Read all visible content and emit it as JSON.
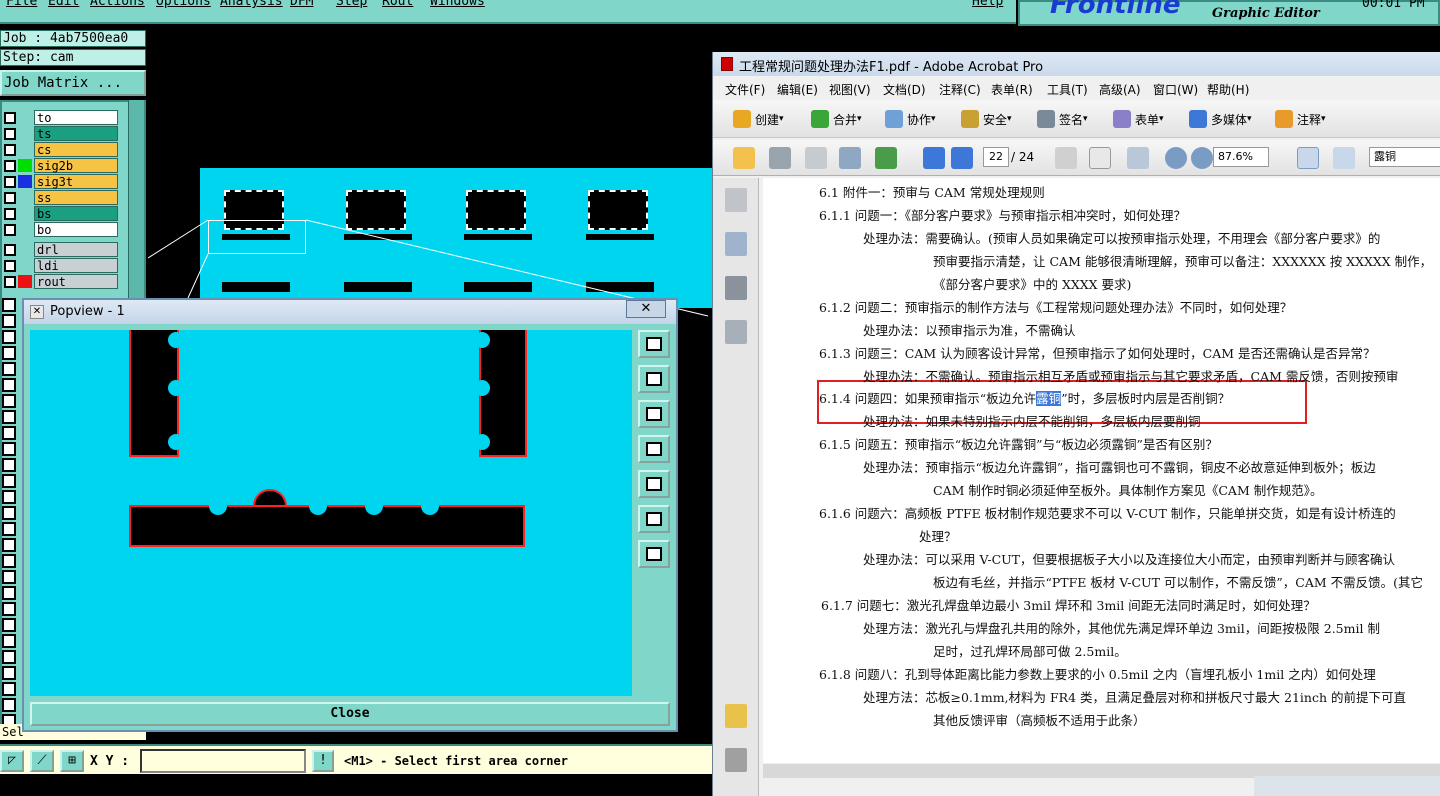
{
  "genesis": {
    "menu": [
      "File",
      "Edit",
      "Actions",
      "Options",
      "Analysis",
      "DFM",
      "Step",
      "Rout",
      "Windows"
    ],
    "help": "Help",
    "brand_logo": "Frontline",
    "brand_sub": "Graphic Editor",
    "brand_time": "00:01 PM",
    "job_label": "Job : 4ab7500ea0",
    "step_label": "Step: cam",
    "job_matrix": "Job Matrix ...",
    "layers": [
      {
        "name": "to",
        "color": "#ffffff"
      },
      {
        "name": "ts",
        "color": "#1aa080"
      },
      {
        "name": "cs",
        "color": "#f6c344"
      },
      {
        "name": "sig2b",
        "color": "#f6c344",
        "swatch": "#00dd00"
      },
      {
        "name": "sig3t",
        "color": "#f6c344",
        "swatch": "#1a2fe0"
      },
      {
        "name": "ss",
        "color": "#f6c344"
      },
      {
        "name": "bs",
        "color": "#1aa080"
      },
      {
        "name": "bo",
        "color": "#ffffff"
      },
      {
        "name": "drl",
        "color": "#c8d0d4"
      },
      {
        "name": "ldi",
        "color": "#c8d0d4"
      },
      {
        "name": "rout",
        "color": "#c8d0d4",
        "swatch": "#ee1111"
      }
    ],
    "sel_strip": "Sel",
    "xy_label": "X Y :",
    "xy_value": "",
    "status_message": "<M1> - Select first area corner"
  },
  "popview": {
    "title": "Popview - 1",
    "close_label": "Close",
    "close_icon": "close-icon"
  },
  "acrobat": {
    "title": "工程常规问题处理办法F1.pdf - Adobe Acrobat Pro",
    "menu": [
      "文件(F)",
      "编辑(E)",
      "视图(V)",
      "文档(D)",
      "注释(C)",
      "表单(R)",
      "工具(T)",
      "高级(A)",
      "窗口(W)",
      "帮助(H)"
    ],
    "toolbar1": [
      "创建",
      "合并",
      "协作",
      "安全",
      "签名",
      "表单",
      "多媒体",
      "注释"
    ],
    "page_current": "22",
    "page_total": "/ 24",
    "zoom": "87.6%",
    "find_text": "露铜",
    "lines": [
      "6.1  附件一：预审与 CAM 常规处理规则",
      "6.1.1 问题一：《部分客户要求》与预审指示相冲突时，如何处理？",
      "处理办法：需要确认。(预审人员如果确定可以按预审指示处理，不用理会《部分客户要求》的",
      "预审要指示清楚，让 CAM 能够很清晰理解，预审可以备注：XXXXXX 按 XXXXX 制作，",
      "《部分客户要求》中的 XXXX 要求)",
      "6.1.2 问题二：预审指示的制作方法与《工程常规问题处理办法》不同时，如何处理？",
      "处理办法：以预审指示为准，不需确认",
      "6.1.3 问题三：CAM 认为顾客设计异常，但预审指示了如何处理时，CAM 是否还需确认是否异常？",
      "处理办法：不需确认。预审指示相互矛盾或预审指示与其它要求矛盾，CAM 需反馈，否则按预审",
      "6.1.4 问题四：如果预审指示“板边允许",
      "露铜",
      "”时，多层板时内层是否削铜？",
      "处理办法：如果未特别指示内层不能削铜，多层板内层要削铜",
      "6.1.5 问题五：预审指示“板边允许露铜”与“板边必须露铜”是否有区别？",
      "处理办法：预审指示“板边允许露铜”，指可露铜也可不露铜，铜皮不必故意延伸到板外；板边",
      "CAM 制作时铜必须延伸至板外。具体制作方案见《CAM 制作规范》。",
      "6.1.6 问题六：高频板 PTFE 板材制作规范要求不可以 V-CUT 制作，只能单拼交货，如是有设计桥连的",
      "处理？",
      "处理办法：可以采用 V-CUT，但要根据板子大小以及连接位大小而定，由预审判断并与顾客确认",
      "板边有毛丝，并指示“PTFE 板材 V-CUT 可以制作，不需反馈”，CAM 不需反馈。(其它",
      "6.1.7 问题七：激光孔焊盘单边最小 3mil 焊环和 3mil 间距无法同时满足时，如何处理？",
      "处理方法：激光孔与焊盘孔共用的除外，其他优先满足焊环单边 3mil，间距按极限 2.5mil 制",
      "足时，过孔焊环局部可做 2.5mil。",
      "6.1.8 问题八：孔到导体距离比能力参数上要求的小 0.5mil 之内（盲埋孔板小 1mil 之内）如何处理",
      "处理方法：芯板≥0.1mm,材料为 FR4 类，且满足叠层对称和拼板尺寸最大 21inch 的前提下可直",
      "其他反馈评审（高频板不适用于此条）"
    ]
  },
  "colors": {
    "teal": "#7fd6c9",
    "cyan_copper": "#00d5f0",
    "highlight_red": "#e02020"
  }
}
